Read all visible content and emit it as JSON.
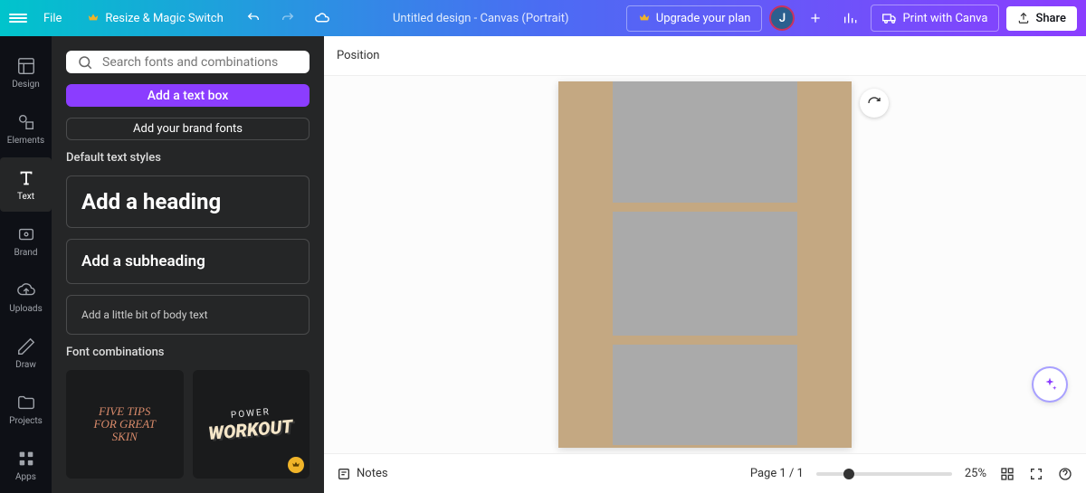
{
  "topbar": {
    "file_label": "File",
    "resize_label": "Resize & Magic Switch",
    "title": "Untitled design - Canvas (Portrait)",
    "upgrade_label": "Upgrade your plan",
    "avatar_initial": "J",
    "print_label": "Print with Canva",
    "share_label": "Share"
  },
  "sidebar": {
    "items": [
      {
        "label": "Design"
      },
      {
        "label": "Elements"
      },
      {
        "label": "Text"
      },
      {
        "label": "Brand"
      },
      {
        "label": "Uploads"
      },
      {
        "label": "Draw"
      },
      {
        "label": "Projects"
      },
      {
        "label": "Apps"
      }
    ],
    "active_index": 2
  },
  "text_panel": {
    "search_placeholder": "Search fonts and combinations",
    "add_text_box": "Add a text box",
    "brand_fonts": "Add your brand fonts",
    "default_styles_label": "Default text styles",
    "heading": "Add a heading",
    "subheading": "Add a subheading",
    "body": "Add a little bit of body text",
    "font_combos_label": "Font combinations",
    "combo1": "FIVE TIPS\nFOR GREAT\nSKIN",
    "combo2_top": "POWER",
    "combo2_bottom": "WORKOUT"
  },
  "canvas": {
    "position_label": "Position"
  },
  "bottombar": {
    "notes_label": "Notes",
    "page_label": "Page 1 / 1",
    "zoom_label": "25%"
  }
}
